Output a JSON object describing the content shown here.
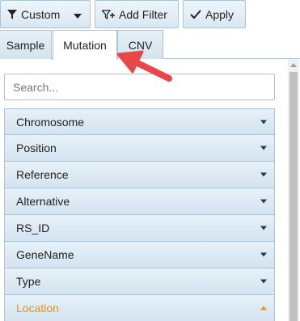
{
  "toolbar": {
    "custom_label": "Custom",
    "add_filter_label": "Add Filter",
    "apply_label": "Apply"
  },
  "tabs": [
    {
      "label": "Sample",
      "active": false
    },
    {
      "label": "Mutation",
      "active": true
    },
    {
      "label": "CNV",
      "active": false
    }
  ],
  "search": {
    "placeholder": "Search...",
    "value": ""
  },
  "fields": [
    {
      "label": "Chromosome",
      "expanded": false
    },
    {
      "label": "Position",
      "expanded": false
    },
    {
      "label": "Reference",
      "expanded": false
    },
    {
      "label": "Alternative",
      "expanded": false
    },
    {
      "label": "RS_ID",
      "expanded": false
    },
    {
      "label": "GeneName",
      "expanded": false
    },
    {
      "label": "Type",
      "expanded": false
    },
    {
      "label": "Location",
      "expanded": true
    }
  ],
  "colors": {
    "accent_active": "#e8921c",
    "annotation_arrow": "#e8474a",
    "border": "#a9c4d8"
  },
  "icons": {
    "custom": "filter-icon",
    "add_filter": "add-filter-icon",
    "apply": "checkmark-icon",
    "dropdown": "caret-down-icon"
  }
}
